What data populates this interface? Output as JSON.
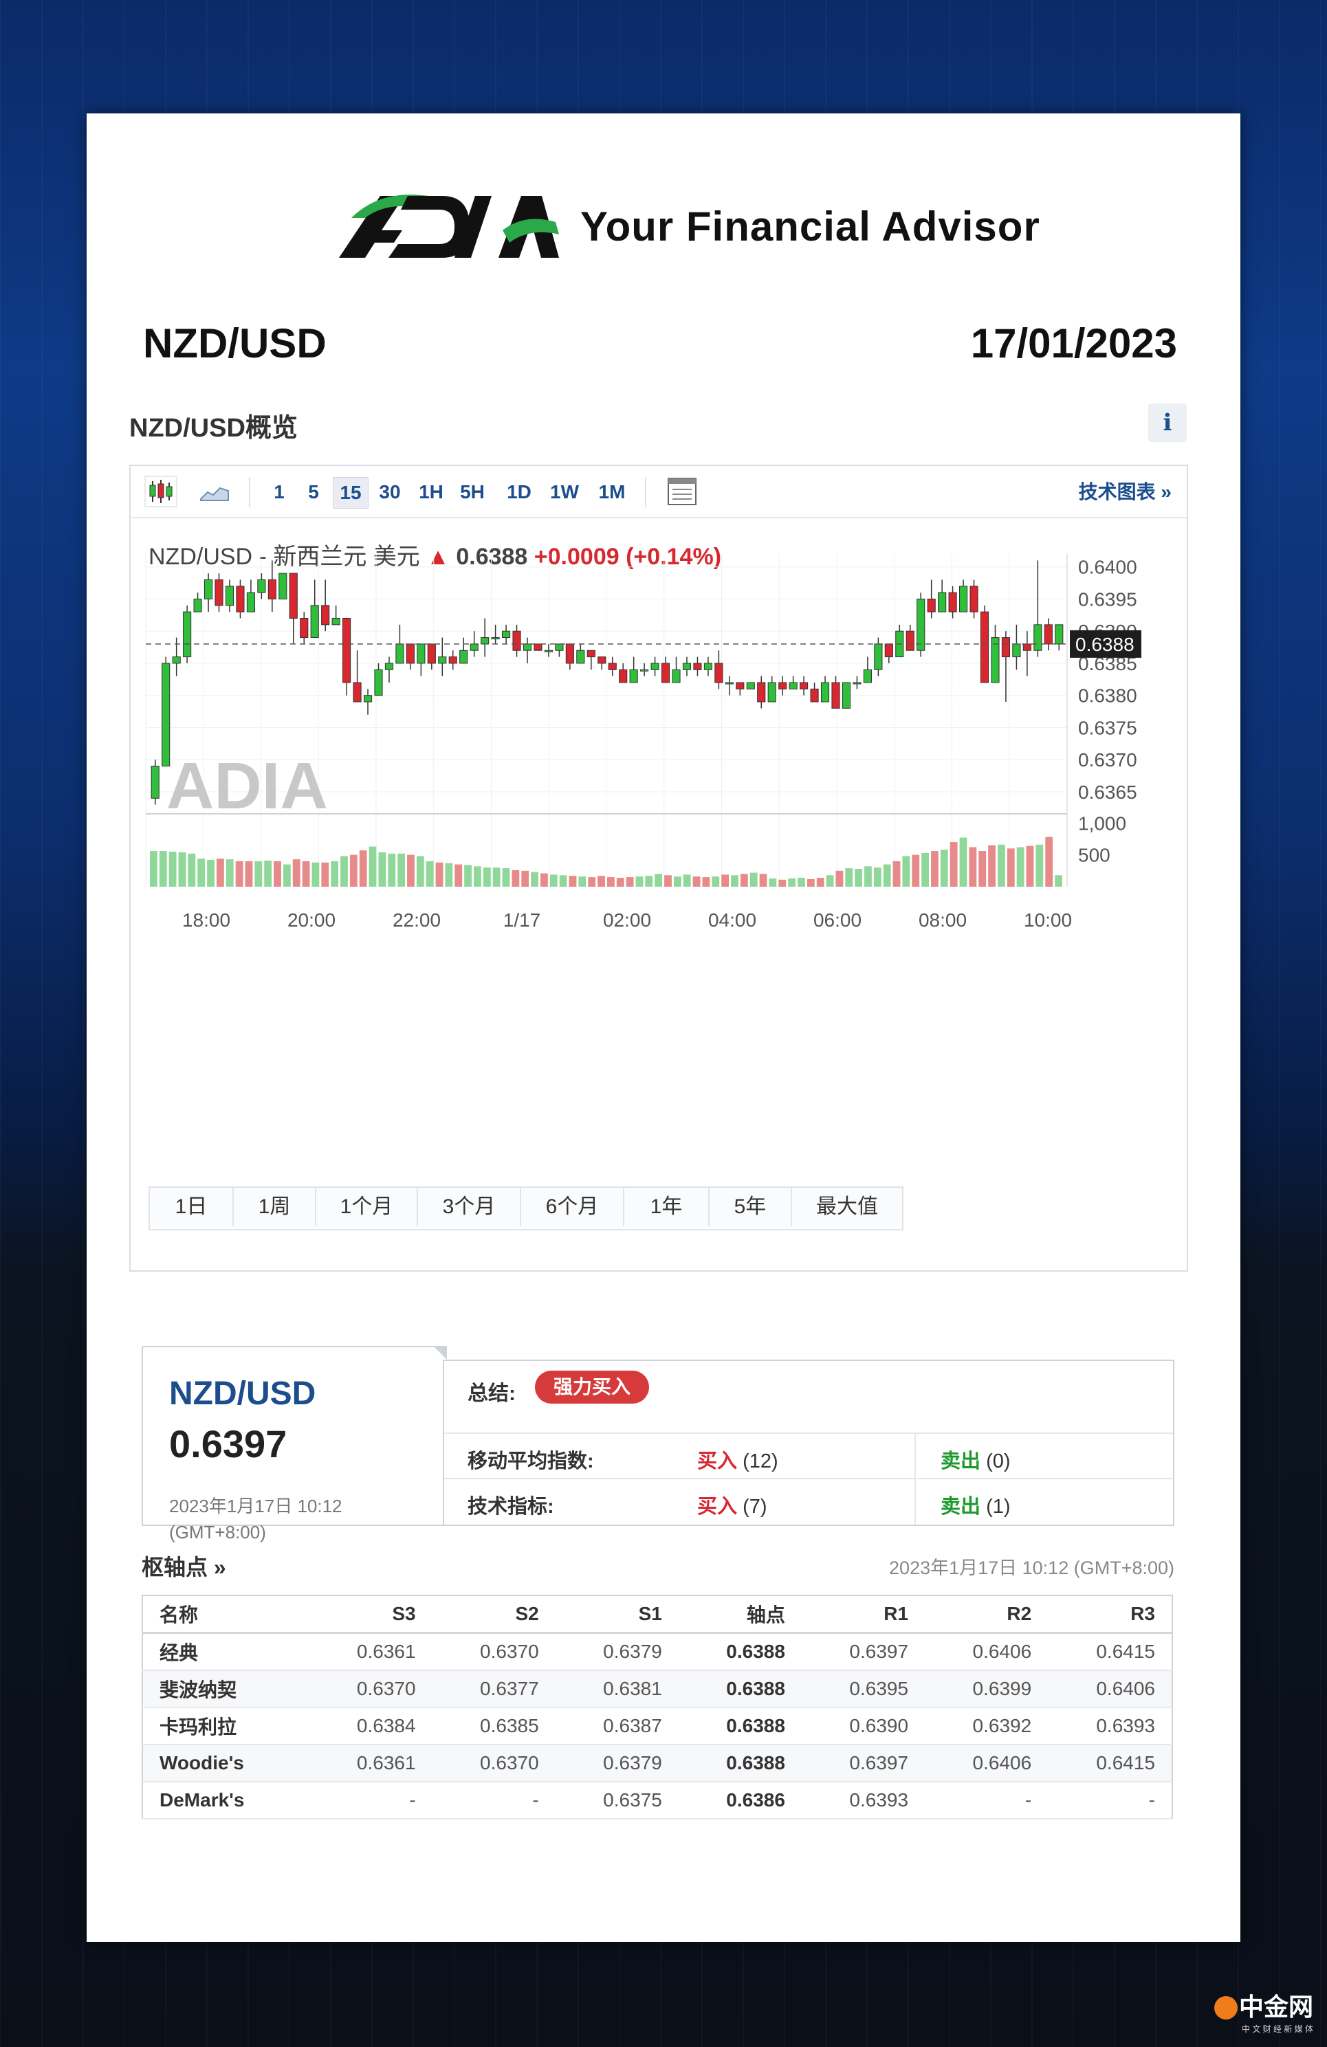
{
  "brand": {
    "logo_text": "ADIA",
    "tagline": "Your Financial Advisor",
    "footer_site": "中金网",
    "footer_sub": "中 文 财 经 新 媒 体"
  },
  "header": {
    "pair": "NZD/USD",
    "date": "17/01/2023"
  },
  "overview": {
    "title": "NZD/USD概览",
    "info_label": "i"
  },
  "toolbar": {
    "intervals": [
      "1",
      "5",
      "15",
      "30",
      "1H",
      "5H",
      "1D",
      "1W",
      "1M"
    ],
    "active_interval": "15",
    "tech_chart_link": "技术图表 »"
  },
  "quote": {
    "name": "NZD/USD - 新西兰元 美元",
    "arrow": "▲",
    "price": "0.6388",
    "change": "+0.0009",
    "change_pct": "(+0.14%)"
  },
  "watermark": "ADIA",
  "chart_data": {
    "type": "candlestick",
    "current_price": 0.6388,
    "current_label": "0.6388",
    "y_ticks": [
      0.64,
      0.6395,
      0.639,
      0.6385,
      0.638,
      0.6375,
      0.637,
      0.6365
    ],
    "y_tick_labels": [
      "0.6400",
      "0.6395",
      "0.6390",
      "0.6385",
      "0.6380",
      "0.6375",
      "0.6370",
      "0.6365"
    ],
    "ylim": [
      0.6362,
      0.6402
    ],
    "x_tick_labels": [
      "18:00",
      "20:00",
      "22:00",
      "1/17",
      "02:00",
      "04:00",
      "06:00",
      "08:00",
      "10:00"
    ],
    "volume_ticks": [
      "1,000",
      "500"
    ],
    "volume_max": 1100,
    "up_color": "#2fbf3a",
    "down_color": "#d8272e",
    "candles": [
      [
        0.6364,
        0.6369,
        0.6363,
        0.637
      ],
      [
        0.6369,
        0.6385,
        0.6369,
        0.6386
      ],
      [
        0.6385,
        0.6386,
        0.6383,
        0.6389
      ],
      [
        0.6386,
        0.6393,
        0.6385,
        0.6394
      ],
      [
        0.6393,
        0.6395,
        0.6393,
        0.6396
      ],
      [
        0.6395,
        0.6398,
        0.6393,
        0.6399
      ],
      [
        0.6398,
        0.6394,
        0.6393,
        0.6399
      ],
      [
        0.6394,
        0.6397,
        0.6393,
        0.6398
      ],
      [
        0.6397,
        0.6393,
        0.6392,
        0.6398
      ],
      [
        0.6393,
        0.6396,
        0.6393,
        0.6398
      ],
      [
        0.6396,
        0.6398,
        0.6395,
        0.6399
      ],
      [
        0.6398,
        0.6395,
        0.6393,
        0.6401
      ],
      [
        0.6395,
        0.6399,
        0.6395,
        0.6399
      ],
      [
        0.6399,
        0.6392,
        0.6388,
        0.6399
      ],
      [
        0.6392,
        0.6389,
        0.6388,
        0.6393
      ],
      [
        0.6389,
        0.6394,
        0.6389,
        0.6398
      ],
      [
        0.6394,
        0.6391,
        0.639,
        0.6398
      ],
      [
        0.6391,
        0.6392,
        0.6391,
        0.6394
      ],
      [
        0.6392,
        0.6382,
        0.638,
        0.6392
      ],
      [
        0.6382,
        0.6379,
        0.6379,
        0.6387
      ],
      [
        0.6379,
        0.638,
        0.6377,
        0.6381
      ],
      [
        0.638,
        0.6384,
        0.638,
        0.6385
      ],
      [
        0.6384,
        0.6385,
        0.6382,
        0.6386
      ],
      [
        0.6385,
        0.6388,
        0.6385,
        0.6391
      ],
      [
        0.6388,
        0.6385,
        0.6384,
        0.6388
      ],
      [
        0.6385,
        0.6388,
        0.6383,
        0.6388
      ],
      [
        0.6388,
        0.6385,
        0.6384,
        0.6388
      ],
      [
        0.6385,
        0.6386,
        0.6383,
        0.6389
      ],
      [
        0.6386,
        0.6385,
        0.6384,
        0.6387
      ],
      [
        0.6385,
        0.6387,
        0.6385,
        0.6389
      ],
      [
        0.6387,
        0.6388,
        0.6386,
        0.639
      ],
      [
        0.6388,
        0.6389,
        0.6386,
        0.6392
      ],
      [
        0.6389,
        0.6389,
        0.6388,
        0.6391
      ],
      [
        0.6389,
        0.639,
        0.6388,
        0.6391
      ],
      [
        0.639,
        0.6387,
        0.6386,
        0.6391
      ],
      [
        0.6387,
        0.6388,
        0.6385,
        0.6389
      ],
      [
        0.6388,
        0.6387,
        0.6387,
        0.6388
      ],
      [
        0.6387,
        0.6387,
        0.6386,
        0.6388
      ],
      [
        0.6387,
        0.6388,
        0.6386,
        0.6388
      ],
      [
        0.6388,
        0.6385,
        0.6384,
        0.6388
      ],
      [
        0.6385,
        0.6387,
        0.6385,
        0.6388
      ],
      [
        0.6387,
        0.6386,
        0.6384,
        0.6387
      ],
      [
        0.6386,
        0.6385,
        0.6384,
        0.6386
      ],
      [
        0.6385,
        0.6384,
        0.6383,
        0.6386
      ],
      [
        0.6384,
        0.6382,
        0.6382,
        0.6385
      ],
      [
        0.6382,
        0.6384,
        0.6382,
        0.6386
      ],
      [
        0.6384,
        0.6384,
        0.6383,
        0.6385
      ],
      [
        0.6384,
        0.6385,
        0.6383,
        0.6386
      ],
      [
        0.6385,
        0.6382,
        0.6382,
        0.6386
      ],
      [
        0.6382,
        0.6384,
        0.6382,
        0.6386
      ],
      [
        0.6384,
        0.6385,
        0.6383,
        0.6386
      ],
      [
        0.6385,
        0.6384,
        0.6383,
        0.6386
      ],
      [
        0.6384,
        0.6385,
        0.6383,
        0.6386
      ],
      [
        0.6385,
        0.6382,
        0.6381,
        0.6387
      ],
      [
        0.6382,
        0.6382,
        0.638,
        0.6383
      ],
      [
        0.6382,
        0.6381,
        0.638,
        0.6382
      ],
      [
        0.6381,
        0.6382,
        0.6381,
        0.6382
      ],
      [
        0.6382,
        0.6379,
        0.6378,
        0.6383
      ],
      [
        0.6379,
        0.6382,
        0.6379,
        0.6383
      ],
      [
        0.6382,
        0.6381,
        0.638,
        0.6383
      ],
      [
        0.6381,
        0.6382,
        0.6381,
        0.6383
      ],
      [
        0.6382,
        0.6381,
        0.638,
        0.6383
      ],
      [
        0.6381,
        0.6379,
        0.6379,
        0.6382
      ],
      [
        0.6379,
        0.6382,
        0.6379,
        0.6383
      ],
      [
        0.6382,
        0.6378,
        0.6378,
        0.6383
      ],
      [
        0.6378,
        0.6382,
        0.6378,
        0.6382
      ],
      [
        0.6382,
        0.6382,
        0.6381,
        0.6383
      ],
      [
        0.6382,
        0.6384,
        0.6382,
        0.6386
      ],
      [
        0.6384,
        0.6388,
        0.6383,
        0.6389
      ],
      [
        0.6388,
        0.6386,
        0.6385,
        0.6388
      ],
      [
        0.6386,
        0.639,
        0.6386,
        0.6391
      ],
      [
        0.639,
        0.6387,
        0.6387,
        0.6391
      ],
      [
        0.6387,
        0.6395,
        0.6386,
        0.6396
      ],
      [
        0.6395,
        0.6393,
        0.6392,
        0.6398
      ],
      [
        0.6393,
        0.6396,
        0.6393,
        0.6398
      ],
      [
        0.6396,
        0.6393,
        0.6392,
        0.6397
      ],
      [
        0.6393,
        0.6397,
        0.6393,
        0.6398
      ],
      [
        0.6397,
        0.6393,
        0.6392,
        0.6398
      ],
      [
        0.6393,
        0.6382,
        0.6382,
        0.6394
      ],
      [
        0.6382,
        0.6389,
        0.6382,
        0.6391
      ],
      [
        0.6389,
        0.6386,
        0.6379,
        0.639
      ],
      [
        0.6386,
        0.6388,
        0.6384,
        0.6391
      ],
      [
        0.6388,
        0.6387,
        0.6383,
        0.639
      ],
      [
        0.6387,
        0.6391,
        0.6386,
        0.6401
      ],
      [
        0.6391,
        0.6388,
        0.6387,
        0.6392
      ],
      [
        0.6388,
        0.6391,
        0.6387,
        0.6391
      ]
    ],
    "volumes": [
      560,
      560,
      550,
      540,
      520,
      440,
      420,
      440,
      430,
      400,
      400,
      400,
      410,
      400,
      350,
      430,
      400,
      380,
      380,
      400,
      480,
      500,
      570,
      630,
      540,
      520,
      520,
      500,
      480,
      400,
      380,
      370,
      350,
      340,
      320,
      300,
      300,
      290,
      260,
      250,
      230,
      210,
      190,
      180,
      170,
      160,
      150,
      170,
      150,
      140,
      150,
      160,
      170,
      200,
      180,
      160,
      190,
      160,
      150,
      160,
      190,
      180,
      200,
      220,
      200,
      130,
      110,
      130,
      140,
      120,
      140,
      180,
      250,
      290,
      280,
      320,
      300,
      350,
      400,
      480,
      500,
      530,
      560,
      580,
      700,
      770,
      620,
      560,
      650,
      660,
      600,
      620,
      640,
      660,
      780,
      180
    ]
  },
  "ranges": [
    "1日",
    "1周",
    "1个月",
    "3个月",
    "6个月",
    "1年",
    "5年",
    "最大值"
  ],
  "summary": {
    "pair": "NZD/USD",
    "price": "0.6397",
    "time": "2023年1月17日 10:12 (GMT+8:00)",
    "label": "总结:",
    "badge": "强力买入",
    "rows": [
      {
        "key": "移动平均指数:",
        "buy": "买入",
        "buy_count": "(12)",
        "sell": "卖出",
        "sell_count": "(0)"
      },
      {
        "key": "技术指标:",
        "buy": "买入",
        "buy_count": "(7)",
        "sell": "卖出",
        "sell_count": "(1)"
      }
    ]
  },
  "pivot": {
    "title": "枢轴点 »",
    "time": "2023年1月17日 10:12 (GMT+8:00)",
    "headers": [
      "名称",
      "S3",
      "S2",
      "S1",
      "轴点",
      "R1",
      "R2",
      "R3"
    ],
    "rows": [
      [
        "经典",
        "0.6361",
        "0.6370",
        "0.6379",
        "0.6388",
        "0.6397",
        "0.6406",
        "0.6415"
      ],
      [
        "斐波纳契",
        "0.6370",
        "0.6377",
        "0.6381",
        "0.6388",
        "0.6395",
        "0.6399",
        "0.6406"
      ],
      [
        "卡玛利拉",
        "0.6384",
        "0.6385",
        "0.6387",
        "0.6388",
        "0.6390",
        "0.6392",
        "0.6393"
      ],
      [
        "Woodie's",
        "0.6361",
        "0.6370",
        "0.6379",
        "0.6388",
        "0.6397",
        "0.6406",
        "0.6415"
      ],
      [
        "DeMark's",
        "-",
        "-",
        "0.6375",
        "0.6386",
        "0.6393",
        "-",
        "-"
      ]
    ]
  }
}
